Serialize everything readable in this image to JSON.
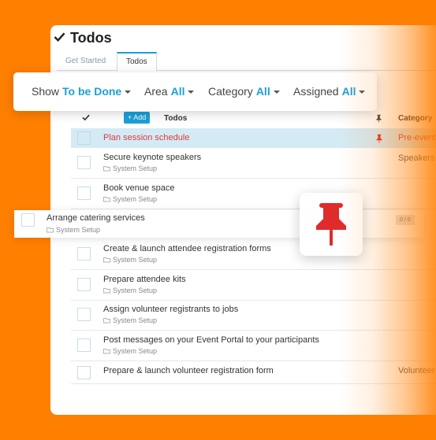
{
  "page": {
    "title": "Todos"
  },
  "tabs": [
    {
      "label": "Get Started"
    },
    {
      "label": "Todos"
    }
  ],
  "filters": {
    "show": {
      "label": "Show",
      "value": "To be Done"
    },
    "area": {
      "label": "Area",
      "value": "All"
    },
    "category": {
      "label": "Category",
      "value": "All"
    },
    "assigned": {
      "label": "Assigned",
      "value": "All"
    }
  },
  "table": {
    "add_label": "+ Add",
    "col_todos": "Todos",
    "col_category": "Category"
  },
  "rows": [
    {
      "title": "Plan session schedule",
      "sub": "",
      "category": "Pre-event",
      "pinned": true
    },
    {
      "title": "Secure keynote speakers",
      "sub": "System Setup",
      "category": "Speakers"
    },
    {
      "title": "Book venue space",
      "sub": "System Setup",
      "category": ""
    },
    {
      "title": "Create & launch attendee registration forms",
      "sub": "System Setup",
      "category": ""
    },
    {
      "title": "Prepare attendee kits",
      "sub": "System Setup",
      "category": ""
    },
    {
      "title": "Assign volunteer registrants to jobs",
      "sub": "System Setup",
      "category": ""
    },
    {
      "title": "Post messages on your Event Portal to your participants",
      "sub": "System Setup",
      "category": ""
    },
    {
      "title": "Prepare & launch volunteer registration form",
      "sub": "",
      "category": "Volunteer"
    }
  ],
  "drag_row": {
    "title": "Arrange catering services",
    "sub": "System Setup",
    "badge": "0 / 0"
  },
  "colors": {
    "brand": "#ff7f00",
    "accent": "#1ba0d8",
    "pin": "#e02b2b"
  }
}
